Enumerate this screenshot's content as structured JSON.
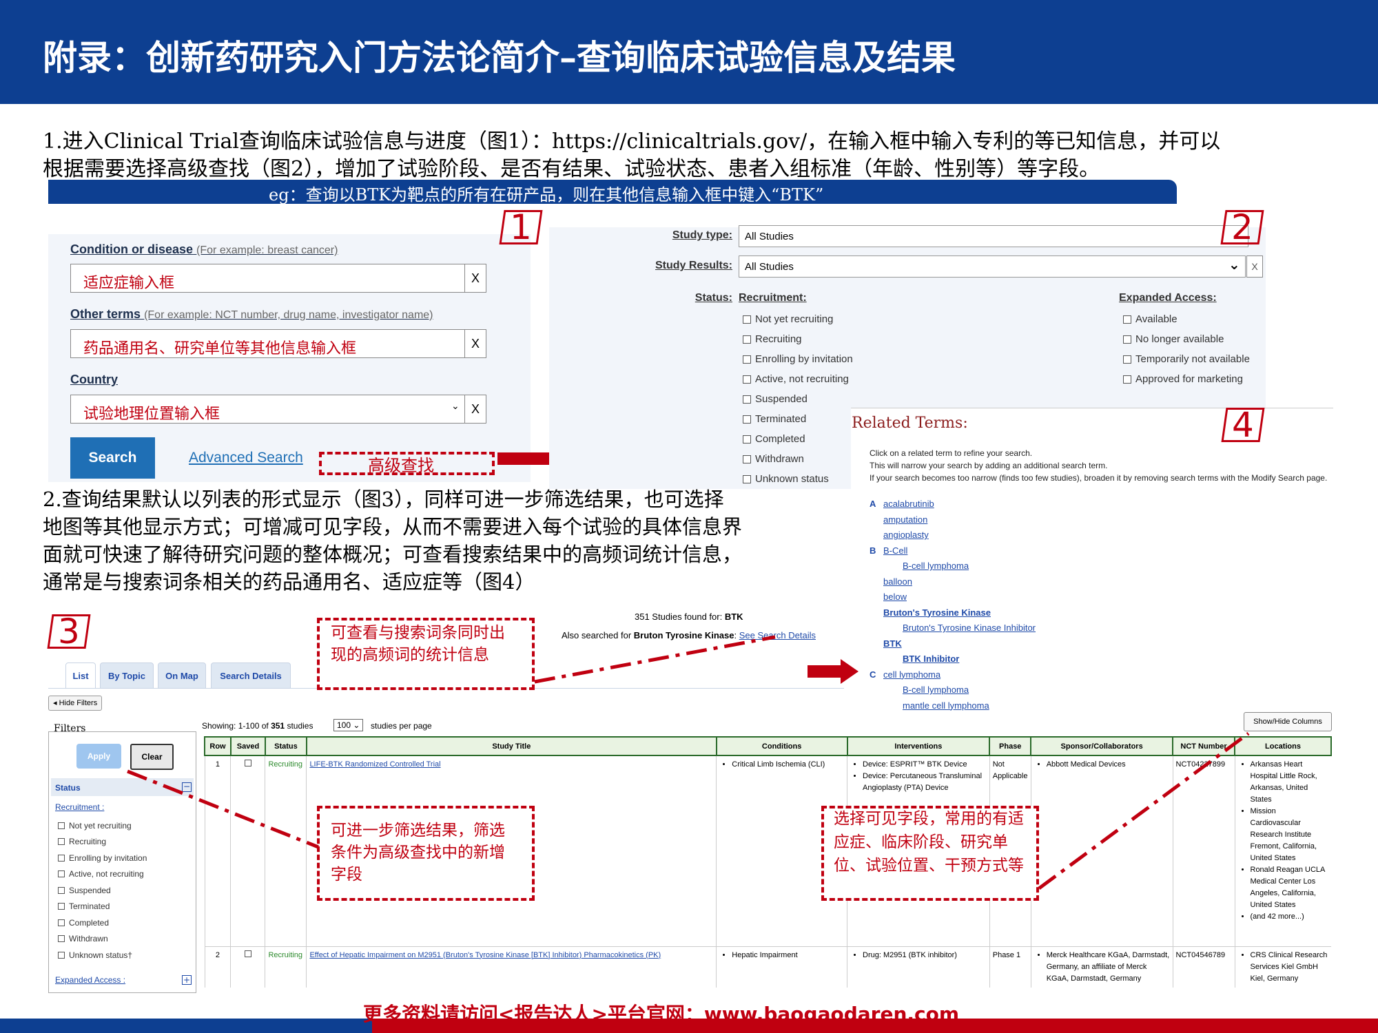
{
  "header": {
    "title": "附录：创新药研究入门方法论简介–查询临床试验信息及结果"
  },
  "intro": {
    "line1": "1.进入Clinical Trial查询临床试验信息与进度（图1）：https://clinicaltrials.gov/，在输入框中输入专利的等已知信息，并可以",
    "line2": "根据需要选择高级查找（图2），增加了试验阶段、是否有结果、试验状态、患者入组标准（年龄、性别等）等字段。",
    "eg": "eg：查询以BTK为靶点的所有在研产品，则在其他信息输入框中键入“BTK”"
  },
  "numbers": {
    "n1": "1",
    "n2": "2",
    "n3": "3",
    "n4": "4"
  },
  "fig1": {
    "condition_label": "Condition or disease",
    "condition_hint": "(For example: breast cancer)",
    "condition_value": "适应症输入框",
    "other_label": "Other terms",
    "other_hint": "(For example: NCT number, drug name, investigator name)",
    "other_value": "药品通用名、研究单位等其他信息输入框",
    "country_label": "Country",
    "country_value": "试验地理位置输入框",
    "clear": "X",
    "search_button": "Search",
    "advanced_link": "Advanced Search",
    "advanced_note": "高级查找"
  },
  "fig2": {
    "study_type_label": "Study type:",
    "study_type_value": "All Studies",
    "study_results_label": "Study Results:",
    "study_results_value": "All Studies",
    "status_label": "Status:",
    "recruitment_label": "Recruitment:",
    "recruitment": [
      "Not yet recruiting",
      "Recruiting",
      "Enrolling by invitation",
      "Active, not recruiting",
      "Suspended",
      "Terminated",
      "Completed",
      "Withdrawn",
      "Unknown status"
    ],
    "expanded_label": "Expanded Access:",
    "expanded": [
      "Available",
      "No longer available",
      "Temporarily not available",
      "Approved for marketing"
    ]
  },
  "para2": {
    "line1": "2.查询结果默认以列表的形式显示（图3），同样可进一步筛选结果，也可选择",
    "line2": "地图等其他显示方式；可增减可见字段，从而不需要进入每个试验的具体信息界",
    "line3": "面就可快速了解待研究问题的整体概况；可查看搜索结果中的高频词统计信息，",
    "line4": "通常是与搜索词条相关的药品通用名、适应症等（图4）"
  },
  "fig4": {
    "title": "Related Terms:",
    "desc1": "Click on a related term to refine your search.",
    "desc2": "This will narrow your search by adding an additional search term.",
    "desc3": "If your search becomes too narrow (finds too few studies), broaden it by removing search terms with the Modify Search page.",
    "terms": [
      {
        "letter": "A",
        "text": "acalabrutinib",
        "indent": 0,
        "bold": false
      },
      {
        "letter": "",
        "text": "amputation",
        "indent": 0,
        "bold": false
      },
      {
        "letter": "",
        "text": "angioplasty",
        "indent": 0,
        "bold": false
      },
      {
        "letter": "B",
        "text": "B-Cell",
        "indent": 0,
        "bold": false
      },
      {
        "letter": "",
        "text": "B-cell lymphoma",
        "indent": 1,
        "bold": false
      },
      {
        "letter": "",
        "text": "balloon",
        "indent": 0,
        "bold": false
      },
      {
        "letter": "",
        "text": "below",
        "indent": 0,
        "bold": false
      },
      {
        "letter": "",
        "text": "Bruton's Tyrosine Kinase",
        "indent": 0,
        "bold": true
      },
      {
        "letter": "",
        "text": "Bruton's Tyrosine Kinase Inhibitor",
        "indent": 1,
        "bold": false
      },
      {
        "letter": "",
        "text": "BTK",
        "indent": 0,
        "bold": true
      },
      {
        "letter": "",
        "text": "BTK Inhibitor",
        "indent": 1,
        "bold": true
      },
      {
        "letter": "C",
        "text": "cell lymphoma",
        "indent": 0,
        "bold": false
      },
      {
        "letter": "",
        "text": "B-cell lymphoma",
        "indent": 1,
        "bold": false
      },
      {
        "letter": "",
        "text": "mantle cell lymphoma",
        "indent": 1,
        "bold": false
      }
    ]
  },
  "fig3": {
    "found": "351 Studies found for: ",
    "found_term": "BTK",
    "also_prefix": "Also searched for ",
    "also_term": "Bruton Tyrosine Kinase",
    "also_sep": ": ",
    "see_details": "See Search Details",
    "tabs": [
      "List",
      "By Topic",
      "On Map",
      "Search Details"
    ],
    "hide_filters": "◂ Hide Filters",
    "filters_label": "Filters",
    "apply": "Apply",
    "clear": "Clear",
    "status_label": "Status",
    "recruitment_label": "Recruitment :",
    "recruitment": [
      "Not yet recruiting",
      "Recruiting",
      "Enrolling by invitation",
      "Active, not recruiting",
      "Suspended",
      "Terminated",
      "Completed",
      "Withdrawn",
      "Unknown status†"
    ],
    "expanded_label": "Expanded Access :",
    "showing_prefix": "Showing: 1-100 of ",
    "showing_total": "351",
    "showing_suffix": " studies",
    "per_page_value": "100",
    "per_page_suffix": "studies per page",
    "show_hide": "Show/Hide Columns",
    "columns": [
      "Row",
      "Saved",
      "Status",
      "Study Title",
      "Conditions",
      "Interventions",
      "Phase",
      "Sponsor/Collaborators",
      "NCT Number",
      "Locations"
    ],
    "rows": [
      {
        "row": "1",
        "status": "Recruiting",
        "title": "LIFE-BTK Randomized Controlled Trial",
        "conditions": [
          "Critical Limb Ischemia (CLI)"
        ],
        "interventions": [
          "Device: ESPRIT™ BTK Device",
          "Device: Percutaneous Transluminal Angioplasty (PTA) Device"
        ],
        "phase": "Not Applicable",
        "sponsor": [
          "Abbott Medical Devices"
        ],
        "nct": "NCT04227899",
        "locations": [
          "Arkansas Heart Hospital Little Rock, Arkansas, United States",
          "Mission Cardiovascular Research Institute Fremont, California, United States",
          "Ronald Reagan UCLA Medical Center Los Angeles, California, United States",
          "(and 42 more...)"
        ]
      },
      {
        "row": "2",
        "status": "Recruiting",
        "title": "Effect of Hepatic Impairment on M2951 (Bruton's Tyrosine Kinase [BTK] Inhibitor) Pharmacokinetics (PK)",
        "conditions": [
          "Hepatic Impairment"
        ],
        "interventions": [
          "Drug: M2951 (BTK inhibitor)"
        ],
        "phase": "Phase 1",
        "sponsor": [
          "Merck Healthcare KGaA, Darmstadt, Germany, an affiliate of Merck KGaA, Darmstadt, Germany"
        ],
        "nct": "NCT04546789",
        "locations": [
          "CRS Clinical Research Services Kiel GmbH Kiel, Germany"
        ]
      }
    ]
  },
  "notes": {
    "high_freq": "可查看与搜索词条同时出现的高频词的统计信息",
    "filter": "可进一步筛选结果，筛选条件为高级查找中的新增字段",
    "columns": "选择可见字段，常用的有适应症、临床阶段、研究单位、试验位置、干预方式等"
  },
  "footer": {
    "text": "更多资料请访问<报告达人>平台官网：www.baogaodaren.com"
  },
  "colors": {
    "brand_blue": "#0d3f91",
    "accent_red": "#c00010"
  }
}
